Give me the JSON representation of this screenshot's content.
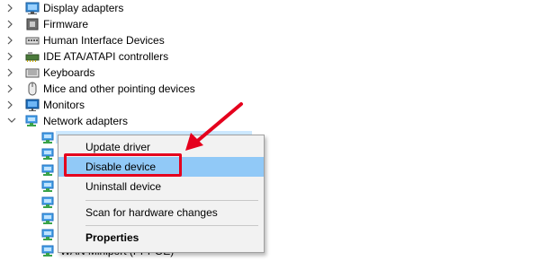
{
  "tree": {
    "categories": [
      {
        "label": "Display adapters",
        "icon": "display-adapter-icon",
        "expanded": false
      },
      {
        "label": "Firmware",
        "icon": "firmware-icon",
        "expanded": false
      },
      {
        "label": "Human Interface Devices",
        "icon": "hid-icon",
        "expanded": false
      },
      {
        "label": "IDE ATA/ATAPI controllers",
        "icon": "ide-controller-icon",
        "expanded": false
      },
      {
        "label": "Keyboards",
        "icon": "keyboard-icon",
        "expanded": false
      },
      {
        "label": "Mice and other pointing devices",
        "icon": "mouse-icon",
        "expanded": false
      },
      {
        "label": "Monitors",
        "icon": "monitor-icon",
        "expanded": false
      },
      {
        "label": "Network adapters",
        "icon": "network-adapter-icon",
        "expanded": true
      }
    ],
    "partial_child_label": "WAN Miniport (PPPOE)"
  },
  "context_menu": {
    "items": [
      {
        "label": "Update driver"
      },
      {
        "label": "Disable device",
        "highlighted": true
      },
      {
        "label": "Uninstall device"
      },
      {
        "label": "Scan for hardware changes"
      },
      {
        "label": "Properties",
        "bold": true
      }
    ]
  },
  "colors": {
    "highlight": "#91c9f7",
    "selection": "#cce8ff",
    "annotation_red": "#e5001d"
  }
}
